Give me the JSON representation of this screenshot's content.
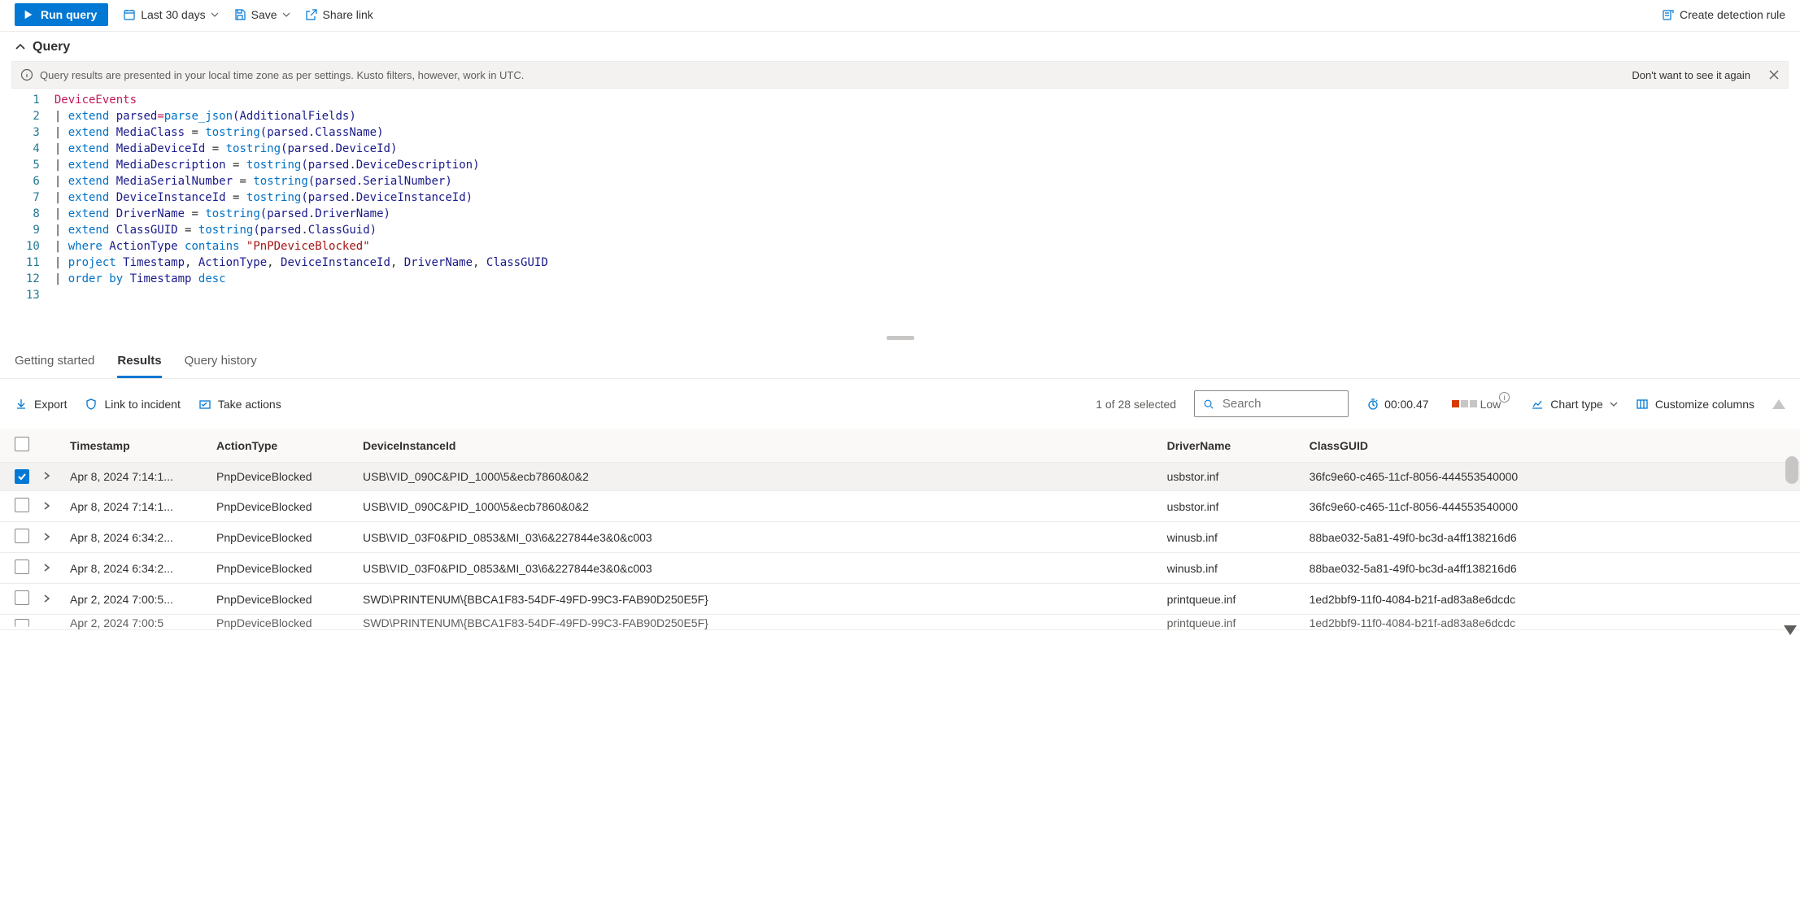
{
  "toolbar": {
    "run_label": "Run query",
    "timerange_label": "Last 30 days",
    "save_label": "Save",
    "share_label": "Share link",
    "create_rule_label": "Create detection rule"
  },
  "query_header": "Query",
  "banner": {
    "message": "Query results are presented in your local time zone as per settings. Kusto filters, however, work in UTC.",
    "dismiss": "Don't want to see it again"
  },
  "editor": {
    "line_count": 13,
    "lines": [
      [
        [
          "tk-tbl",
          "DeviceEvents"
        ]
      ],
      [
        [
          "tk-pipe",
          "| "
        ],
        [
          "tk-op",
          "extend "
        ],
        [
          "tk-id",
          "parsed"
        ],
        [
          "tk-assign",
          "="
        ],
        [
          "tk-fn",
          "parse_json"
        ],
        [
          "tk-paren",
          "("
        ],
        [
          "tk-field",
          "AdditionalFields"
        ],
        [
          "tk-paren",
          ")"
        ]
      ],
      [
        [
          "tk-pipe",
          "| "
        ],
        [
          "tk-op",
          "extend "
        ],
        [
          "tk-id",
          "MediaClass"
        ],
        [
          "tk-pipe",
          " = "
        ],
        [
          "tk-fn",
          "tostring"
        ],
        [
          "tk-paren",
          "("
        ],
        [
          "tk-field",
          "parsed"
        ],
        [
          "tk-pipe",
          "."
        ],
        [
          "tk-field",
          "ClassName"
        ],
        [
          "tk-paren",
          ")"
        ]
      ],
      [
        [
          "tk-pipe",
          "| "
        ],
        [
          "tk-op",
          "extend "
        ],
        [
          "tk-id",
          "MediaDeviceId"
        ],
        [
          "tk-pipe",
          " = "
        ],
        [
          "tk-fn",
          "tostring"
        ],
        [
          "tk-paren",
          "("
        ],
        [
          "tk-field",
          "parsed"
        ],
        [
          "tk-pipe",
          "."
        ],
        [
          "tk-field",
          "DeviceId"
        ],
        [
          "tk-paren",
          ")"
        ]
      ],
      [
        [
          "tk-pipe",
          "| "
        ],
        [
          "tk-op",
          "extend "
        ],
        [
          "tk-id",
          "MediaDescription"
        ],
        [
          "tk-pipe",
          " = "
        ],
        [
          "tk-fn",
          "tostring"
        ],
        [
          "tk-paren",
          "("
        ],
        [
          "tk-field",
          "parsed"
        ],
        [
          "tk-pipe",
          "."
        ],
        [
          "tk-field",
          "DeviceDescription"
        ],
        [
          "tk-paren",
          ")"
        ]
      ],
      [
        [
          "tk-pipe",
          "| "
        ],
        [
          "tk-op",
          "extend "
        ],
        [
          "tk-id",
          "MediaSerialNumber"
        ],
        [
          "tk-pipe",
          " = "
        ],
        [
          "tk-fn",
          "tostring"
        ],
        [
          "tk-paren",
          "("
        ],
        [
          "tk-field",
          "parsed"
        ],
        [
          "tk-pipe",
          "."
        ],
        [
          "tk-field",
          "SerialNumber"
        ],
        [
          "tk-paren",
          ")"
        ]
      ],
      [
        [
          "tk-pipe",
          "| "
        ],
        [
          "tk-op",
          "extend "
        ],
        [
          "tk-id",
          "DeviceInstanceId"
        ],
        [
          "tk-pipe",
          " = "
        ],
        [
          "tk-fn",
          "tostring"
        ],
        [
          "tk-paren",
          "("
        ],
        [
          "tk-field",
          "parsed"
        ],
        [
          "tk-pipe",
          "."
        ],
        [
          "tk-field",
          "DeviceInstanceId"
        ],
        [
          "tk-paren",
          ")"
        ]
      ],
      [
        [
          "tk-pipe",
          "| "
        ],
        [
          "tk-op",
          "extend "
        ],
        [
          "tk-id",
          "DriverName"
        ],
        [
          "tk-pipe",
          " = "
        ],
        [
          "tk-fn",
          "tostring"
        ],
        [
          "tk-paren",
          "("
        ],
        [
          "tk-field",
          "parsed"
        ],
        [
          "tk-pipe",
          "."
        ],
        [
          "tk-field",
          "DriverName"
        ],
        [
          "tk-paren",
          ")"
        ]
      ],
      [
        [
          "tk-pipe",
          "| "
        ],
        [
          "tk-op",
          "extend "
        ],
        [
          "tk-id",
          "ClassGUID"
        ],
        [
          "tk-pipe",
          " = "
        ],
        [
          "tk-fn",
          "tostring"
        ],
        [
          "tk-paren",
          "("
        ],
        [
          "tk-field",
          "parsed"
        ],
        [
          "tk-pipe",
          "."
        ],
        [
          "tk-field",
          "ClassGuid"
        ],
        [
          "tk-paren",
          ")"
        ]
      ],
      [
        [
          "tk-pipe",
          "| "
        ],
        [
          "tk-op",
          "where "
        ],
        [
          "tk-id",
          "ActionType"
        ],
        [
          "tk-pipe",
          " "
        ],
        [
          "tk-kw",
          "contains"
        ],
        [
          "tk-pipe",
          " "
        ],
        [
          "tk-str",
          "\"PnPDeviceBlocked\""
        ]
      ],
      [
        [
          "tk-pipe",
          "| "
        ],
        [
          "tk-op",
          "project "
        ],
        [
          "tk-id",
          "Timestamp"
        ],
        [
          "tk-comma",
          ", "
        ],
        [
          "tk-id",
          "ActionType"
        ],
        [
          "tk-comma",
          ", "
        ],
        [
          "tk-id",
          "DeviceInstanceId"
        ],
        [
          "tk-comma",
          ", "
        ],
        [
          "tk-id",
          "DriverName"
        ],
        [
          "tk-comma",
          ", "
        ],
        [
          "tk-id",
          "ClassGUID"
        ]
      ],
      [
        [
          "tk-pipe",
          "| "
        ],
        [
          "tk-op",
          "order "
        ],
        [
          "tk-kw",
          "by "
        ],
        [
          "tk-id",
          "Timestamp"
        ],
        [
          "tk-pipe",
          " "
        ],
        [
          "tk-kw",
          "desc"
        ]
      ]
    ]
  },
  "result_tabs": {
    "getting_started": "Getting started",
    "results": "Results",
    "history": "Query history"
  },
  "result_toolbar": {
    "export": "Export",
    "link_incident": "Link to incident",
    "take_actions": "Take actions",
    "selected_text": "1 of 28 selected",
    "search_placeholder": "Search",
    "timer": "00:00.47",
    "severity_label": "Low",
    "chart_type": "Chart type",
    "customize": "Customize columns"
  },
  "table": {
    "headers": {
      "timestamp": "Timestamp",
      "actiontype": "ActionType",
      "deviceinstance": "DeviceInstanceId",
      "drivername": "DriverName",
      "classguid": "ClassGUID"
    },
    "rows": [
      {
        "selected": true,
        "ts": "Apr 8, 2024 7:14:1...",
        "action": "PnpDeviceBlocked",
        "dev": "USB\\VID_090C&PID_1000\\5&ecb7860&0&2",
        "drv": "usbstor.inf",
        "guid": "36fc9e60-c465-11cf-8056-444553540000"
      },
      {
        "selected": false,
        "ts": "Apr 8, 2024 7:14:1...",
        "action": "PnpDeviceBlocked",
        "dev": "USB\\VID_090C&PID_1000\\5&ecb7860&0&2",
        "drv": "usbstor.inf",
        "guid": "36fc9e60-c465-11cf-8056-444553540000"
      },
      {
        "selected": false,
        "ts": "Apr 8, 2024 6:34:2...",
        "action": "PnpDeviceBlocked",
        "dev": "USB\\VID_03F0&PID_0853&MI_03\\6&227844e3&0&c003",
        "drv": "winusb.inf",
        "guid": "88bae032-5a81-49f0-bc3d-a4ff138216d6"
      },
      {
        "selected": false,
        "ts": "Apr 8, 2024 6:34:2...",
        "action": "PnpDeviceBlocked",
        "dev": "USB\\VID_03F0&PID_0853&MI_03\\6&227844e3&0&c003",
        "drv": "winusb.inf",
        "guid": "88bae032-5a81-49f0-bc3d-a4ff138216d6"
      },
      {
        "selected": false,
        "ts": "Apr 2, 2024 7:00:5...",
        "action": "PnpDeviceBlocked",
        "dev": "SWD\\PRINTENUM\\{BBCA1F83-54DF-49FD-99C3-FAB90D250E5F}",
        "drv": "printqueue.inf",
        "guid": "1ed2bbf9-11f0-4084-b21f-ad83a8e6dcdc"
      }
    ],
    "partial": {
      "ts": "Apr 2, 2024 7:00:5...",
      "action": "PnpDeviceBlocked",
      "dev": "SWD\\PRINTENUM\\{BBCA1F83-54DF-49FD-99C3-FAB90D250E5F}",
      "drv": "printqueue.inf",
      "guid": "1ed2bbf9-11f0-4084-b21f-ad83a8e6dcdc"
    }
  }
}
